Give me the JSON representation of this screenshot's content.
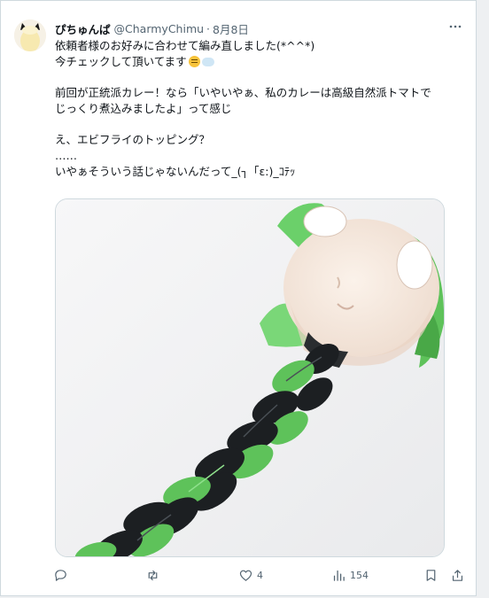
{
  "tweet": {
    "author_name": "ぴちゅんぱ",
    "author_handle": "@CharmyChimu",
    "separator": "·",
    "date": "8月8日",
    "more_icon": "more-icon",
    "text_lines": {
      "l1": "依頼者様のお好みに合わせて編み直しました(*^^*)",
      "l2": "今チェックして頂いてます",
      "l3": "前回が正統派カレー！なら「いやいやぁ、私のカレーは高級自然派トマトで",
      "l4": "じっくり煮込みましたよ」って感じ",
      "l5": "え、エビフライのトッピング？",
      "l6": "……",
      "l7": "いやぁそういう話じゃないんだって_(┐「ε:)_ｺﾃｯ"
    },
    "emojis": [
      "thinking-face-icon",
      "thought-balloon-icon"
    ]
  },
  "actions": {
    "reply": {
      "icon": "reply-icon",
      "count": ""
    },
    "retweet": {
      "icon": "retweet-icon",
      "count": ""
    },
    "like": {
      "icon": "heart-icon",
      "count": "4"
    },
    "views": {
      "icon": "views-icon",
      "count": "154"
    },
    "bookmark": {
      "icon": "bookmark-icon"
    },
    "share": {
      "icon": "share-icon"
    }
  },
  "colors": {
    "secondary_text": "#536471",
    "border": "#cfd9de",
    "hair_green": "#5ec25a",
    "hair_black": "#1c1f22"
  }
}
